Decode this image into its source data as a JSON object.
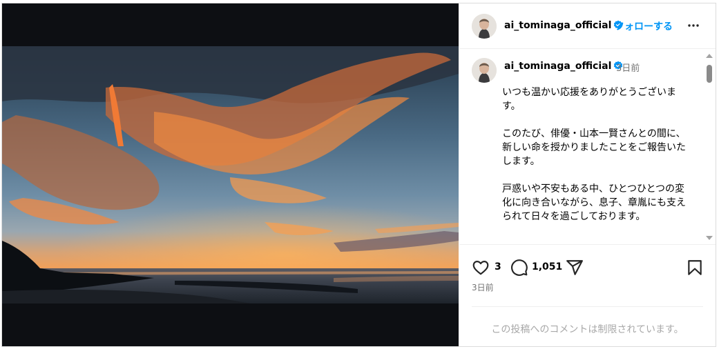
{
  "colors": {
    "accent": "#0095f6",
    "verified": "#0095f6",
    "text_primary": "#000000",
    "text_secondary": "#737373",
    "text_muted": "#a8a8a8",
    "media_background": "#0d0f13"
  },
  "media": {
    "icon": "sunset-photo"
  },
  "header": {
    "username": "ai_tominaga_official",
    "follow_label": "フォローする",
    "verified_icon": "verified-badge-icon",
    "more_icon": "more-options-icon"
  },
  "caption": {
    "username": "ai_tominaga_official",
    "time": "3日前",
    "text": "いつも温かい応援をありがとうございます。\n\nこのたび、俳優・山本一賢さんとの間に、新しい命を授かりましたことをご報告いたします。\n\n戸惑いや不安もある中、ひとつひとつの変化に向き合いながら、息子、章胤にも支えられて日々を過ごしております。"
  },
  "actions": {
    "like_count": "3",
    "comment_count": "1,051",
    "icons": [
      "heart-icon",
      "comment-icon",
      "share-icon",
      "bookmark-icon"
    ]
  },
  "post_time": "3日前",
  "comments_restricted": "この投稿へのコメントは制限されています。"
}
